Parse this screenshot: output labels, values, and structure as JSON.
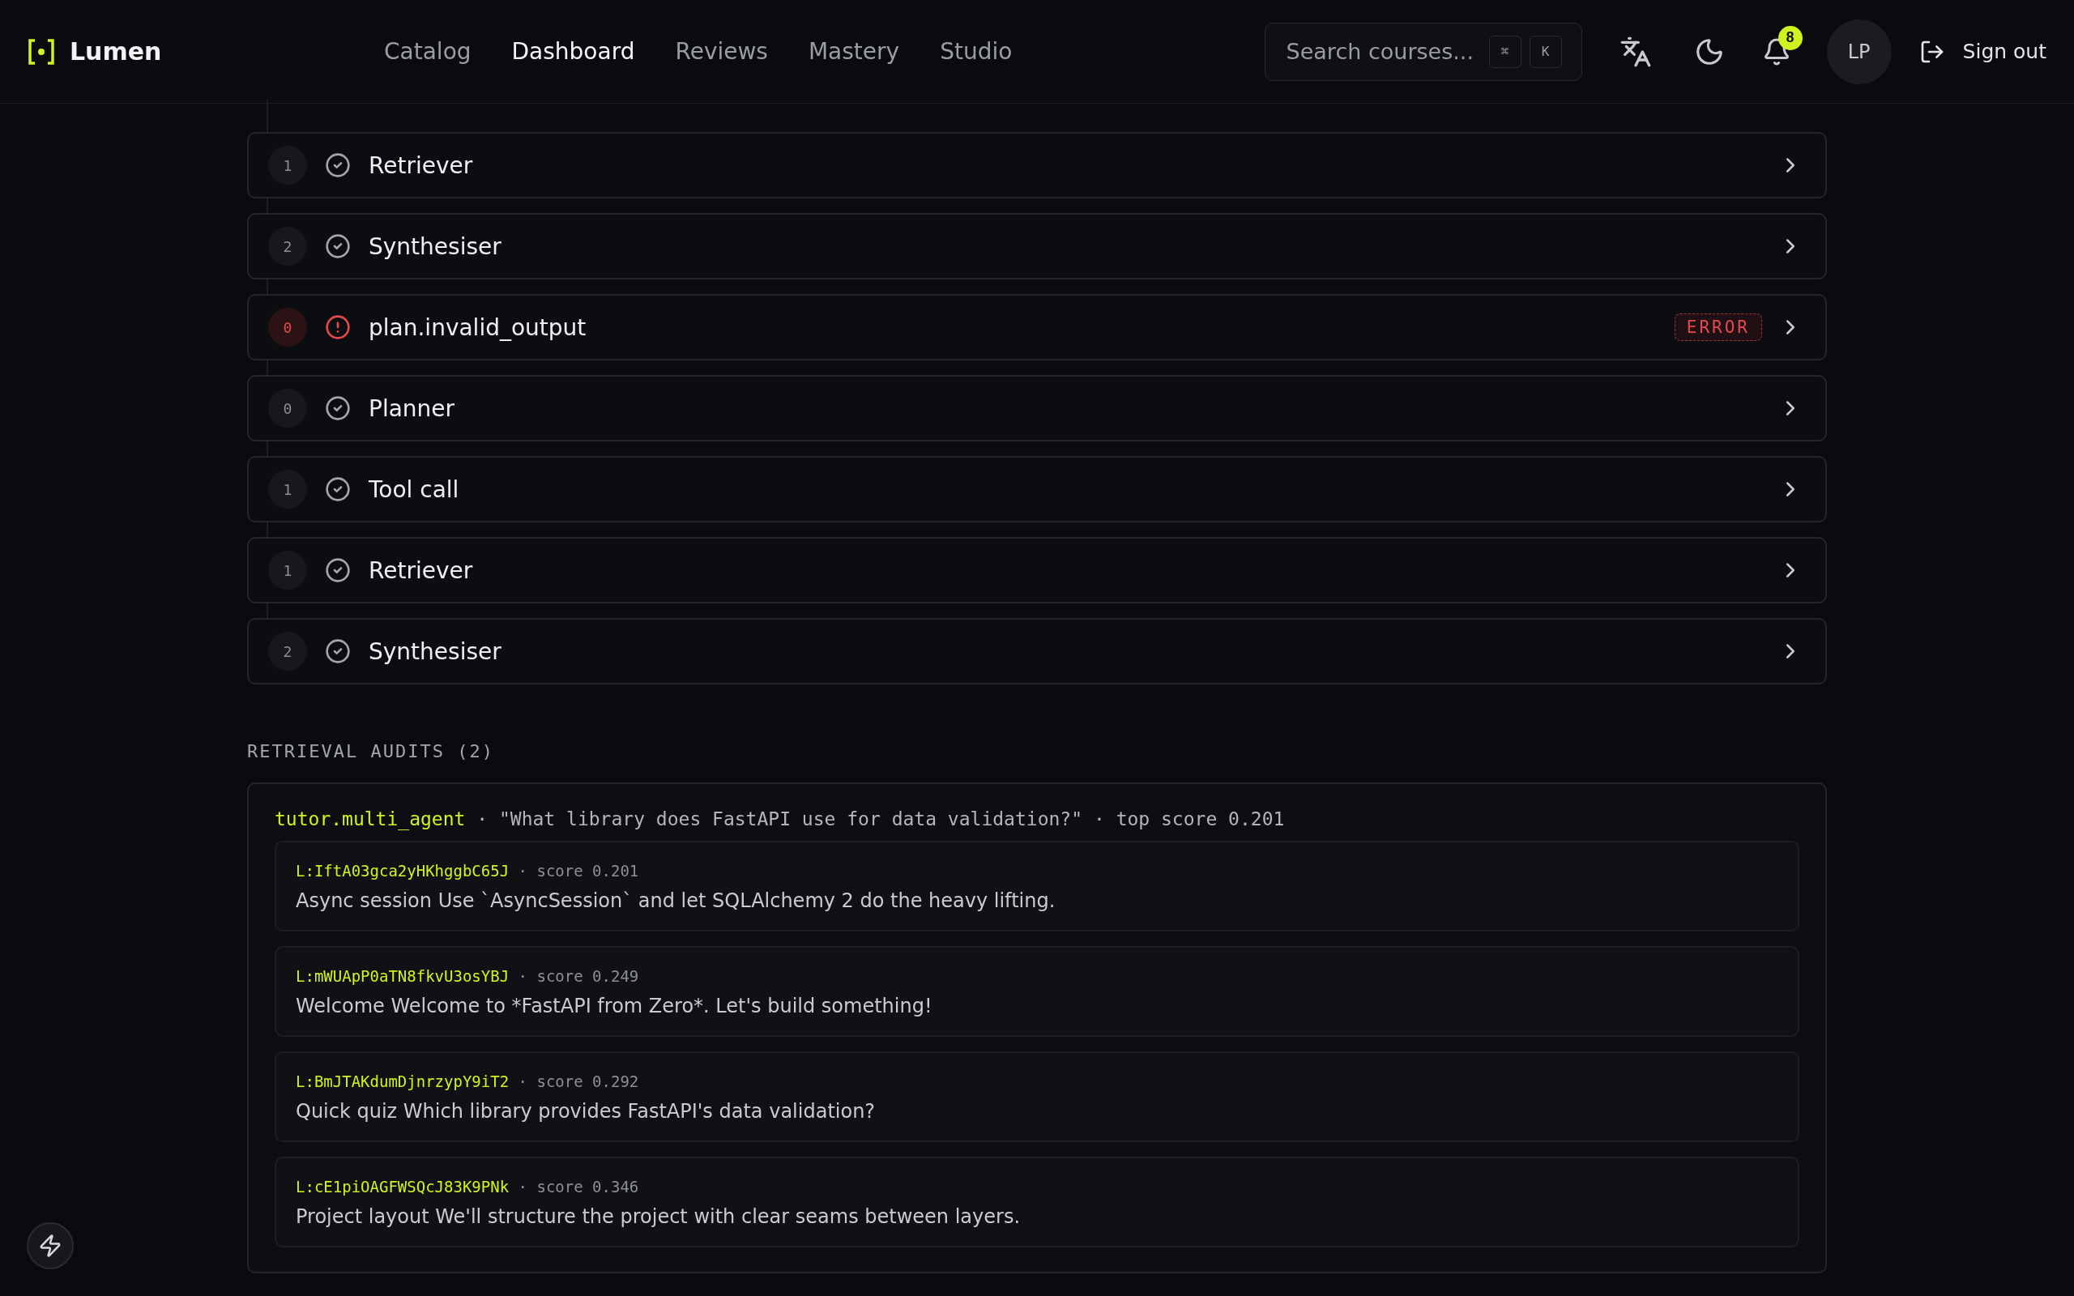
{
  "header": {
    "logo": "Lumen",
    "nav": [
      {
        "label": "Catalog",
        "selected": false
      },
      {
        "label": "Dashboard",
        "selected": true
      },
      {
        "label": "Reviews",
        "selected": false
      },
      {
        "label": "Mastery",
        "selected": false
      },
      {
        "label": "Studio",
        "selected": false
      }
    ],
    "search": {
      "placeholder": "Search courses...",
      "keys": [
        "⌘",
        "K"
      ]
    },
    "notifications": {
      "count": "8"
    },
    "avatar": "LP",
    "sign_out": "Sign out"
  },
  "steps": [
    {
      "index": "1",
      "kind": "ok",
      "label": "Retriever"
    },
    {
      "index": "2",
      "kind": "ok",
      "label": "Synthesiser"
    },
    {
      "index": "0",
      "kind": "error",
      "label": "plan.invalid_output",
      "tag": "ERROR"
    },
    {
      "index": "0",
      "kind": "ok",
      "label": "Planner"
    },
    {
      "index": "1",
      "kind": "ok",
      "label": "Tool call"
    },
    {
      "index": "1",
      "kind": "ok",
      "label": "Retriever"
    },
    {
      "index": "2",
      "kind": "ok",
      "label": "Synthesiser"
    }
  ],
  "audits": {
    "title": "RETRIEVAL AUDITS (2)",
    "cards": [
      {
        "agent": "tutor.multi_agent",
        "separator": "·",
        "query": "\"What library does FastAPI use for data validation?\"",
        "top_score": "top score 0.201",
        "items": [
          {
            "id": "L:IftA03gca2yHKhggbC65J",
            "score": "score 0.201",
            "text": "Async session Use `AsyncSession` and let SQLAlchemy 2 do the heavy lifting."
          },
          {
            "id": "L:mWUApP0aTN8fkvU3osYBJ",
            "score": "score 0.249",
            "text": "Welcome Welcome to *FastAPI from Zero*. Let's build something!"
          },
          {
            "id": "L:BmJTAKdumDjnrzypY9iT2",
            "score": "score 0.292",
            "text": "Quick quiz Which library provides FastAPI's data validation?"
          },
          {
            "id": "L:cE1piOAGFWSQcJ83K9PNk",
            "score": "score 0.346",
            "text": "Project layout We'll structure the project with clear seams between layers."
          }
        ]
      }
    ]
  }
}
